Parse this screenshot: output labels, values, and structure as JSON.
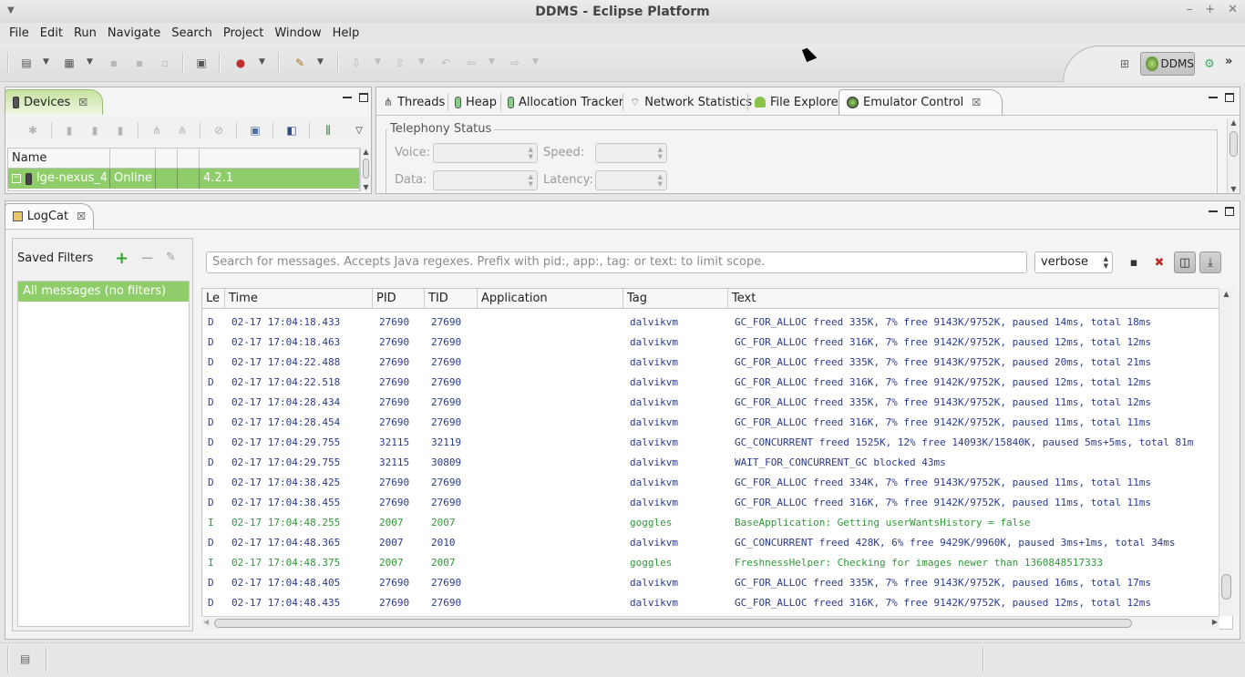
{
  "window": {
    "title": "DDMS - Eclipse Platform"
  },
  "menu": {
    "items": [
      {
        "label": "File"
      },
      {
        "label": "Edit"
      },
      {
        "label": "Run"
      },
      {
        "label": "Navigate"
      },
      {
        "label": "Search"
      },
      {
        "label": "Project"
      },
      {
        "label": "Window"
      },
      {
        "label": "Help"
      }
    ]
  },
  "perspective": {
    "active_label": "DDMS"
  },
  "devices": {
    "tab_label": "Devices",
    "columns": [
      "Name",
      "",
      "",
      "",
      ""
    ],
    "row": {
      "name": "lge-nexus_4",
      "status": "Online",
      "version": "4.2.1"
    }
  },
  "views": {
    "tabs": [
      {
        "label": "Threads"
      },
      {
        "label": "Heap"
      },
      {
        "label": "Allocation Tracker"
      },
      {
        "label": "Network Statistics"
      },
      {
        "label": "File Explorer"
      },
      {
        "label": "Emulator Control"
      }
    ]
  },
  "telephony": {
    "legend": "Telephony Status",
    "voice_label": "Voice:",
    "speed_label": "Speed:",
    "data_label": "Data:",
    "latency_label": "Latency:"
  },
  "logcat": {
    "tab_label": "LogCat",
    "saved_filters_label": "Saved Filters",
    "filters": [
      "All messages (no filters)"
    ],
    "search_placeholder": "Search for messages. Accepts Java regexes. Prefix with pid:, app:, tag: or text: to limit scope.",
    "level": "verbose",
    "columns": [
      "Le",
      "Time",
      "PID",
      "TID",
      "Application",
      "Tag",
      "Text"
    ],
    "rows": [
      {
        "level": "D",
        "time": "02-17 17:04:18.433",
        "pid": "27690",
        "tid": "27690",
        "app": "",
        "tag": "dalvikvm",
        "text": "GC_FOR_ALLOC freed 335K, 7% free 9143K/9752K, paused 14ms, total 18ms"
      },
      {
        "level": "D",
        "time": "02-17 17:04:18.463",
        "pid": "27690",
        "tid": "27690",
        "app": "",
        "tag": "dalvikvm",
        "text": "GC_FOR_ALLOC freed 316K, 7% free 9142K/9752K, paused 12ms, total 12ms"
      },
      {
        "level": "D",
        "time": "02-17 17:04:22.488",
        "pid": "27690",
        "tid": "27690",
        "app": "",
        "tag": "dalvikvm",
        "text": "GC_FOR_ALLOC freed 335K, 7% free 9143K/9752K, paused 20ms, total 21ms"
      },
      {
        "level": "D",
        "time": "02-17 17:04:22.518",
        "pid": "27690",
        "tid": "27690",
        "app": "",
        "tag": "dalvikvm",
        "text": "GC_FOR_ALLOC freed 316K, 7% free 9142K/9752K, paused 12ms, total 12ms"
      },
      {
        "level": "D",
        "time": "02-17 17:04:28.434",
        "pid": "27690",
        "tid": "27690",
        "app": "",
        "tag": "dalvikvm",
        "text": "GC_FOR_ALLOC freed 335K, 7% free 9143K/9752K, paused 11ms, total 12ms"
      },
      {
        "level": "D",
        "time": "02-17 17:04:28.454",
        "pid": "27690",
        "tid": "27690",
        "app": "",
        "tag": "dalvikvm",
        "text": "GC_FOR_ALLOC freed 316K, 7% free 9142K/9752K, paused 11ms, total 11ms"
      },
      {
        "level": "D",
        "time": "02-17 17:04:29.755",
        "pid": "32115",
        "tid": "32119",
        "app": "",
        "tag": "dalvikvm",
        "text": "GC_CONCURRENT freed 1525K, 12% free 14093K/15840K, paused 5ms+5ms, total 81m"
      },
      {
        "level": "D",
        "time": "02-17 17:04:29.755",
        "pid": "32115",
        "tid": "30809",
        "app": "",
        "tag": "dalvikvm",
        "text": "WAIT_FOR_CONCURRENT_GC blocked 43ms"
      },
      {
        "level": "D",
        "time": "02-17 17:04:38.425",
        "pid": "27690",
        "tid": "27690",
        "app": "",
        "tag": "dalvikvm",
        "text": "GC_FOR_ALLOC freed 334K, 7% free 9143K/9752K, paused 11ms, total 11ms"
      },
      {
        "level": "D",
        "time": "02-17 17:04:38.455",
        "pid": "27690",
        "tid": "27690",
        "app": "",
        "tag": "dalvikvm",
        "text": "GC_FOR_ALLOC freed 316K, 7% free 9142K/9752K, paused 11ms, total 11ms"
      },
      {
        "level": "I",
        "time": "02-17 17:04:48.255",
        "pid": "2007",
        "tid": "2007",
        "app": "",
        "tag": "goggles",
        "text": "BaseApplication: Getting userWantsHistory = false"
      },
      {
        "level": "D",
        "time": "02-17 17:04:48.365",
        "pid": "2007",
        "tid": "2010",
        "app": "",
        "tag": "dalvikvm",
        "text": "GC_CONCURRENT freed 428K, 6% free 9429K/9960K, paused 3ms+1ms, total 34ms"
      },
      {
        "level": "I",
        "time": "02-17 17:04:48.375",
        "pid": "2007",
        "tid": "2007",
        "app": "",
        "tag": "goggles",
        "text": "FreshnessHelper: Checking for images newer than 1360848517333"
      },
      {
        "level": "D",
        "time": "02-17 17:04:48.405",
        "pid": "27690",
        "tid": "27690",
        "app": "",
        "tag": "dalvikvm",
        "text": "GC_FOR_ALLOC freed 335K, 7% free 9143K/9752K, paused 16ms, total 17ms"
      },
      {
        "level": "D",
        "time": "02-17 17:04:48.435",
        "pid": "27690",
        "tid": "27690",
        "app": "",
        "tag": "dalvikvm",
        "text": "GC_FOR_ALLOC freed 316K, 7% free 9142K/9752K, paused 12ms, total 12ms"
      }
    ]
  },
  "colors": {
    "selection_green": "#8fcc6a",
    "debug_text": "#2a3b8f",
    "info_text": "#2e9a36"
  }
}
